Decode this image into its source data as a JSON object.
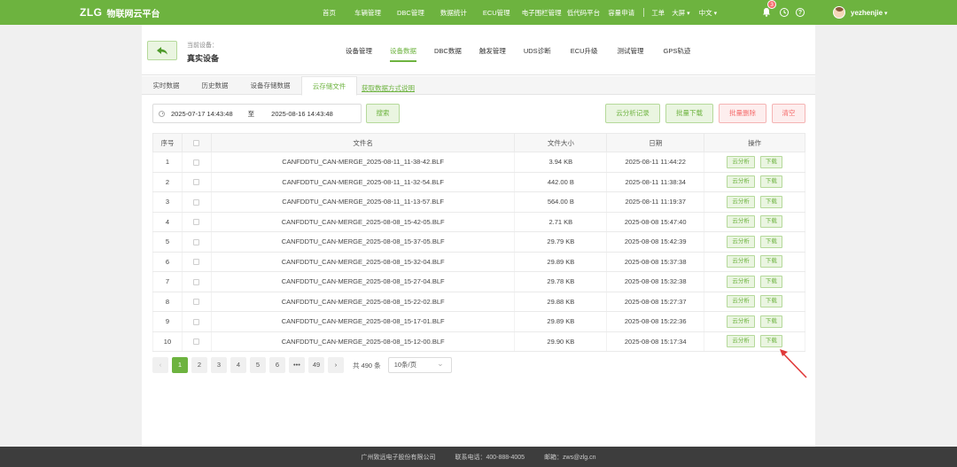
{
  "header": {
    "logo": "ZLG",
    "app_name": "物联网云平台",
    "nav": [
      "首页",
      "车辆管理",
      "DBC管理",
      "数据统计",
      "ECU管理",
      "电子围栏管理",
      "低代码平台",
      "容量申请"
    ],
    "work_order": "工单",
    "big_screen": "大屏",
    "language": "中文",
    "notification_count": "3",
    "help_glyph": "?",
    "username": "yezhenjie"
  },
  "device": {
    "label": "当前设备：",
    "name": "真实设备",
    "nav": [
      "设备管理",
      "设备数据",
      "DBC数据",
      "触发管理",
      "UDS诊断",
      "ECU升级",
      "测试管理",
      "GPS轨迹"
    ],
    "active_nav": "设备数据"
  },
  "tabs": {
    "items": [
      "实时数据",
      "历史数据",
      "设备存储数据",
      "云存储文件"
    ],
    "active": "云存储文件",
    "link": "获取数据方式说明"
  },
  "filter": {
    "start": "2025-07-17 14:43:48",
    "to": "至",
    "end": "2025-08-16 14:43:48",
    "search": "搜索"
  },
  "actions": {
    "cloud_records": "云分析记录",
    "batch_download": "批量下载",
    "batch_delete": "批量删除",
    "clear": "清空"
  },
  "table": {
    "columns": [
      "序号",
      "",
      "文件名",
      "文件大小",
      "日期",
      "操作"
    ],
    "analyze_label": "云分析",
    "download_label": "下载",
    "rows": [
      {
        "no": "1",
        "name": "CANFDDTU_CAN-MERGE_2025-08-11_11-38-42.BLF",
        "size": "3.94 KB",
        "date": "2025-08-11 11:44:22"
      },
      {
        "no": "2",
        "name": "CANFDDTU_CAN-MERGE_2025-08-11_11-32-54.BLF",
        "size": "442.00 B",
        "date": "2025-08-11 11:38:34"
      },
      {
        "no": "3",
        "name": "CANFDDTU_CAN-MERGE_2025-08-11_11-13-57.BLF",
        "size": "564.00 B",
        "date": "2025-08-11 11:19:37"
      },
      {
        "no": "4",
        "name": "CANFDDTU_CAN-MERGE_2025-08-08_15-42-05.BLF",
        "size": "2.71 KB",
        "date": "2025-08-08 15:47:40"
      },
      {
        "no": "5",
        "name": "CANFDDTU_CAN-MERGE_2025-08-08_15-37-05.BLF",
        "size": "29.79 KB",
        "date": "2025-08-08 15:42:39"
      },
      {
        "no": "6",
        "name": "CANFDDTU_CAN-MERGE_2025-08-08_15-32-04.BLF",
        "size": "29.89 KB",
        "date": "2025-08-08 15:37:38"
      },
      {
        "no": "7",
        "name": "CANFDDTU_CAN-MERGE_2025-08-08_15-27-04.BLF",
        "size": "29.78 KB",
        "date": "2025-08-08 15:32:38"
      },
      {
        "no": "8",
        "name": "CANFDDTU_CAN-MERGE_2025-08-08_15-22-02.BLF",
        "size": "29.88 KB",
        "date": "2025-08-08 15:27:37"
      },
      {
        "no": "9",
        "name": "CANFDDTU_CAN-MERGE_2025-08-08_15-17-01.BLF",
        "size": "29.89 KB",
        "date": "2025-08-08 15:22:36"
      },
      {
        "no": "10",
        "name": "CANFDDTU_CAN-MERGE_2025-08-08_15-12-00.BLF",
        "size": "29.90 KB",
        "date": "2025-08-08 15:17:34"
      }
    ]
  },
  "pagination": {
    "prev": "‹",
    "pages": [
      "1",
      "2",
      "3",
      "4",
      "5",
      "6",
      "•••",
      "49"
    ],
    "next": "›",
    "total": "共 490 条",
    "page_size": "10条/页"
  },
  "footer": {
    "company": "广州致远电子股份有限公司",
    "phone": "联系电话：400-888-4005",
    "email": "邮箱：zws@zlg.cn"
  },
  "colors": {
    "brand_green": "#6db33f",
    "danger_red": "#f56c6c",
    "annotation_red": "#e03a3a"
  }
}
